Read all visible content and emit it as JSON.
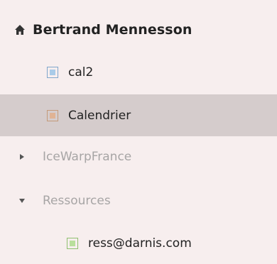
{
  "tree": {
    "owner": {
      "icon": "home-icon",
      "label": "Bertrand Mennesson"
    },
    "calendars": [
      {
        "label": "cal2",
        "selected": false,
        "swatch": {
          "border": "#7fa6cc",
          "fill": "#a9cbe8"
        }
      },
      {
        "label": "Calendrier",
        "selected": true,
        "swatch": {
          "border": "#c49a7a",
          "fill": "#e0b394"
        }
      }
    ],
    "groups": [
      {
        "label": "IceWarpFrance",
        "expanded": false,
        "icon": "caret-right-icon"
      },
      {
        "label": "Ressources",
        "expanded": true,
        "icon": "caret-down-icon",
        "children": [
          {
            "label": "ress@darnis.com",
            "selected": false,
            "swatch": {
              "border": "#8fbf6f",
              "fill": "#b9df9c"
            }
          }
        ]
      }
    ],
    "colors": {
      "background": "#f7eeee",
      "selected_row": "#d5cccc",
      "text": "#222222",
      "muted_text": "#a7a5a5"
    }
  }
}
